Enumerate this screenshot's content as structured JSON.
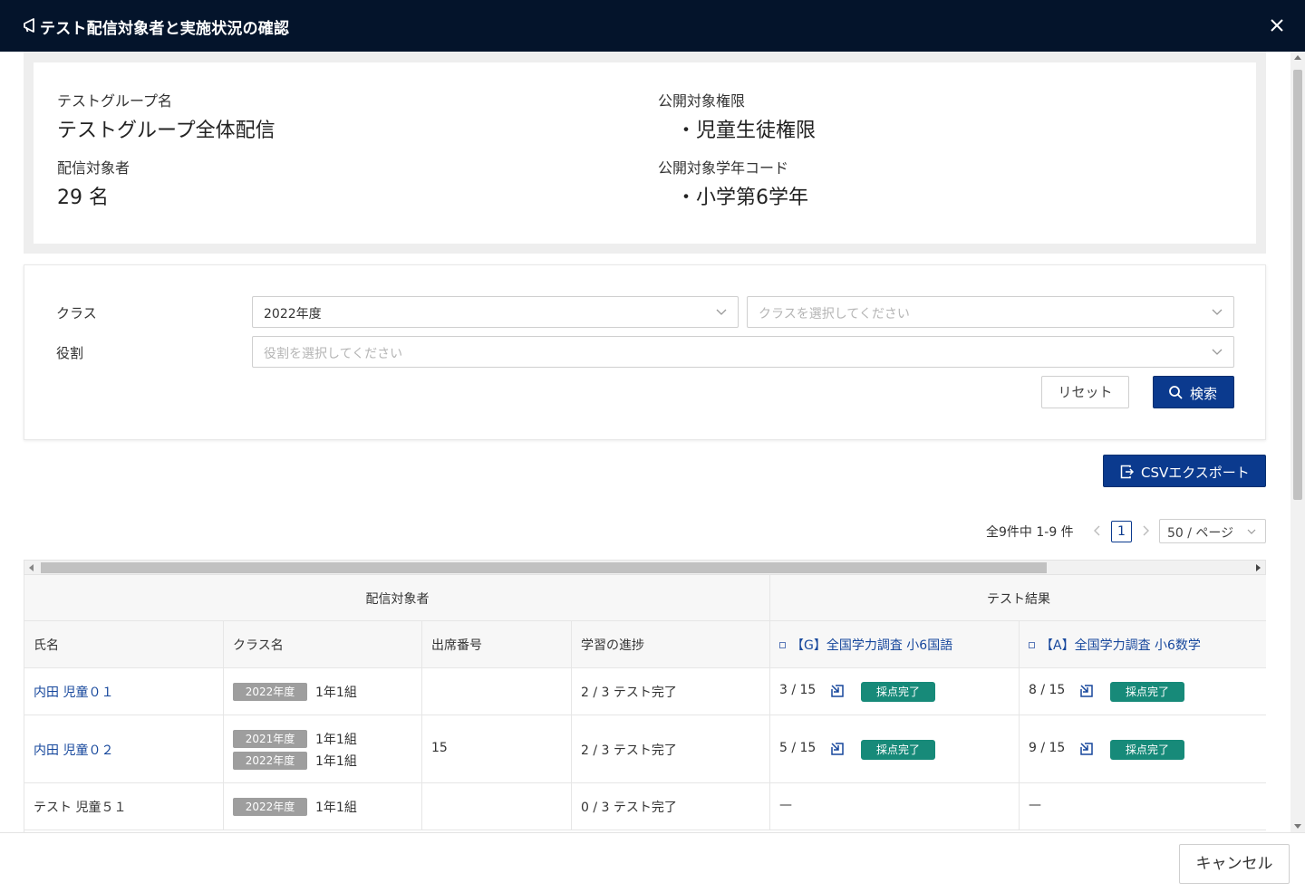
{
  "dialog": {
    "title": "テスト配信対象者と実施状況の確認",
    "cancel_label": "キャンセル"
  },
  "info": {
    "group_name_label": "テストグループ名",
    "group_name": "テストグループ全体配信",
    "targets_label": "配信対象者",
    "targets_value": "29 名",
    "permission_label": "公開対象権限",
    "permission_value": "・児童生徒権限",
    "grade_label": "公開対象学年コード",
    "grade_value": "・小学第6学年"
  },
  "filter": {
    "class_label": "クラス",
    "year_value": "2022年度",
    "class_placeholder": "クラスを選択してください",
    "role_label": "役割",
    "role_placeholder": "役割を選択してください",
    "reset_label": "リセット",
    "search_label": "検索"
  },
  "export": {
    "csv_label": "CSVエクスポート"
  },
  "pagination": {
    "summary": "全9件中 1-9 件",
    "current_page": "1",
    "page_size": "50 / ページ"
  },
  "table": {
    "group_targets": "配信対象者",
    "group_results": "テスト結果",
    "columns": {
      "name": "氏名",
      "class": "クラス名",
      "seat": "出席番号",
      "progress": "学習の進捗",
      "test1": "【G】全国学力調査 小6国語",
      "test2": "【A】全国学力調査 小6数学"
    },
    "rows": [
      {
        "name": "内田 児童０１",
        "classes": [
          {
            "year": "2022年度",
            "name": "1年1組"
          }
        ],
        "seat": "",
        "progress": "2 / 3 テスト完了",
        "test1": {
          "score": "3 / 15",
          "status": "採点完了"
        },
        "test2": {
          "score": "8 / 15",
          "status": "採点完了"
        }
      },
      {
        "name": "内田 児童０２",
        "classes": [
          {
            "year": "2021年度",
            "name": "1年1組"
          },
          {
            "year": "2022年度",
            "name": "1年1組"
          }
        ],
        "seat": "15",
        "progress": "2 / 3 テスト完了",
        "test1": {
          "score": "5 / 15",
          "status": "採点完了"
        },
        "test2": {
          "score": "9 / 15",
          "status": "採点完了"
        }
      },
      {
        "name": "テスト 児童５１",
        "classes": [
          {
            "year": "2022年度",
            "name": "1年1組"
          }
        ],
        "seat": "",
        "progress": "0 / 3 テスト完了",
        "test1": {
          "empty": "—"
        },
        "test2": {
          "empty": "—"
        }
      }
    ]
  },
  "icons": {
    "title": "megaphone-icon",
    "close": "close-icon",
    "search": "search-icon",
    "export": "export-icon",
    "jump": "external-link-icon"
  },
  "colors": {
    "header_bg": "#04142b",
    "primary": "#0b3a8e",
    "link": "#16479c",
    "badge": "#178a79",
    "tag": "#9e9e9e"
  }
}
